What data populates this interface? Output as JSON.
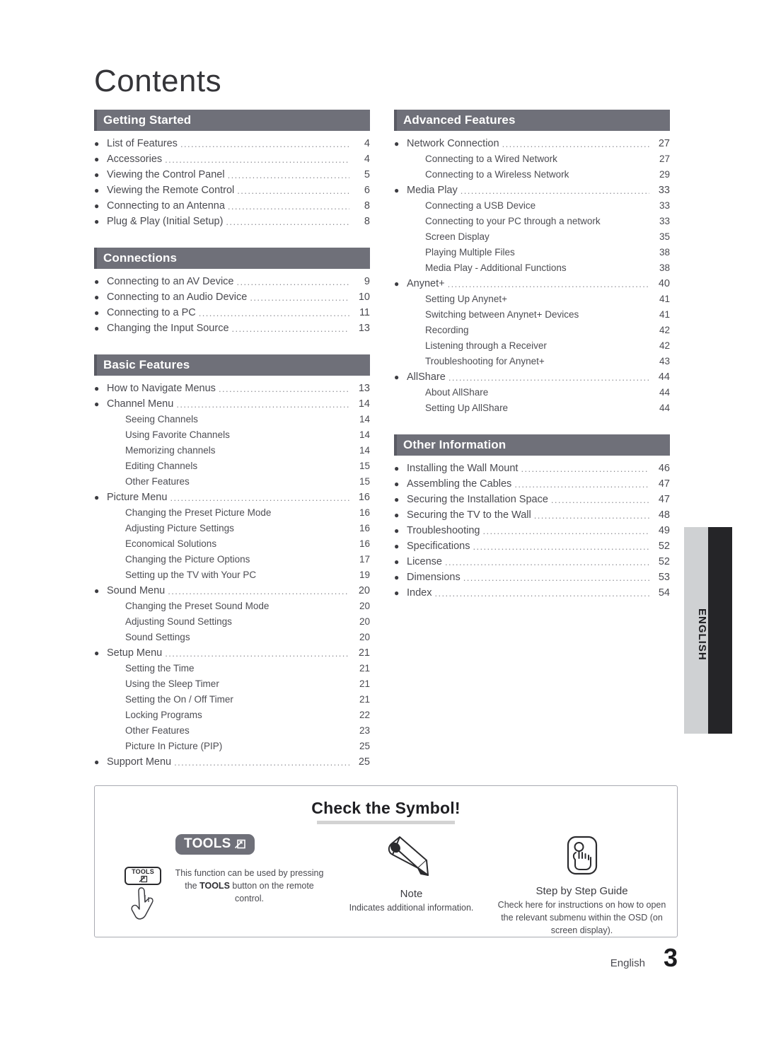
{
  "title": "Contents",
  "side_tab": {
    "label": "ENGLISH"
  },
  "columns": {
    "left": [
      {
        "heading": "Getting Started",
        "entries": [
          {
            "level": "main",
            "text": "List of Features",
            "page": "4"
          },
          {
            "level": "main",
            "text": "Accessories",
            "page": "4"
          },
          {
            "level": "main",
            "text": "Viewing the Control Panel",
            "page": "5"
          },
          {
            "level": "main",
            "text": "Viewing the Remote Control",
            "page": "6"
          },
          {
            "level": "main",
            "text": "Connecting to an Antenna",
            "page": "8"
          },
          {
            "level": "main",
            "text": "Plug & Play (Initial Setup)",
            "page": "8"
          }
        ]
      },
      {
        "heading": "Connections",
        "entries": [
          {
            "level": "main",
            "text": "Connecting to an AV Device",
            "page": "9"
          },
          {
            "level": "main",
            "text": "Connecting to an Audio Device",
            "page": "10"
          },
          {
            "level": "main",
            "text": "Connecting to a PC",
            "page": "11"
          },
          {
            "level": "main",
            "text": "Changing the Input Source",
            "page": "13"
          }
        ]
      },
      {
        "heading": "Basic Features",
        "entries": [
          {
            "level": "main",
            "text": "How to Navigate Menus",
            "page": "13"
          },
          {
            "level": "main",
            "text": "Channel Menu",
            "page": "14"
          },
          {
            "level": "sub",
            "text": "Seeing Channels",
            "page": "14"
          },
          {
            "level": "sub",
            "text": "Using Favorite Channels",
            "page": "14"
          },
          {
            "level": "sub",
            "text": "Memorizing channels",
            "page": "14"
          },
          {
            "level": "sub",
            "text": "Editing Channels",
            "page": "15"
          },
          {
            "level": "sub",
            "text": "Other Features",
            "page": "15"
          },
          {
            "level": "main",
            "text": "Picture Menu",
            "page": "16"
          },
          {
            "level": "sub",
            "text": "Changing the Preset Picture Mode",
            "page": "16"
          },
          {
            "level": "sub",
            "text": "Adjusting Picture Settings",
            "page": "16"
          },
          {
            "level": "sub",
            "text": "Economical Solutions",
            "page": "16"
          },
          {
            "level": "sub",
            "text": "Changing the Picture Options",
            "page": "17"
          },
          {
            "level": "sub",
            "text": "Setting up the TV with Your PC",
            "page": "19"
          },
          {
            "level": "main",
            "text": "Sound Menu",
            "page": "20"
          },
          {
            "level": "sub",
            "text": "Changing the Preset Sound Mode",
            "page": "20"
          },
          {
            "level": "sub",
            "text": "Adjusting Sound Settings",
            "page": "20"
          },
          {
            "level": "sub",
            "text": "Sound Settings",
            "page": "20"
          },
          {
            "level": "main",
            "text": "Setup Menu",
            "page": "21"
          },
          {
            "level": "sub",
            "text": "Setting the Time",
            "page": "21"
          },
          {
            "level": "sub",
            "text": "Using the Sleep Timer",
            "page": "21"
          },
          {
            "level": "sub",
            "text": "Setting the On / Off Timer",
            "page": "21"
          },
          {
            "level": "sub",
            "text": "Locking Programs",
            "page": "22"
          },
          {
            "level": "sub",
            "text": "Other Features",
            "page": "23"
          },
          {
            "level": "sub",
            "text": "Picture In Picture (PIP)",
            "page": "25"
          },
          {
            "level": "main",
            "text": "Support Menu",
            "page": "25"
          }
        ]
      }
    ],
    "right": [
      {
        "heading": "Advanced Features",
        "entries": [
          {
            "level": "main",
            "text": "Network Connection",
            "page": "27"
          },
          {
            "level": "sub",
            "text": "Connecting to a Wired Network",
            "page": "27"
          },
          {
            "level": "sub",
            "text": "Connecting to a Wireless Network",
            "page": "29"
          },
          {
            "level": "main",
            "text": "Media Play",
            "page": "33"
          },
          {
            "level": "sub",
            "text": "Connecting a USB Device",
            "page": "33"
          },
          {
            "level": "sub",
            "text": "Connecting to your PC through a network",
            "page": "33"
          },
          {
            "level": "sub",
            "text": "Screen Display",
            "page": "35"
          },
          {
            "level": "sub",
            "text": "Playing Multiple Files",
            "page": "38"
          },
          {
            "level": "sub",
            "text": "Media Play - Additional Functions",
            "page": "38"
          },
          {
            "level": "main",
            "text": "Anynet+",
            "page": "40"
          },
          {
            "level": "sub",
            "text": "Setting Up Anynet+",
            "page": "41"
          },
          {
            "level": "sub",
            "text": "Switching between Anynet+ Devices",
            "page": "41"
          },
          {
            "level": "sub",
            "text": "Recording",
            "page": "42"
          },
          {
            "level": "sub",
            "text": "Listening through a Receiver",
            "page": "42"
          },
          {
            "level": "sub",
            "text": "Troubleshooting for Anynet+",
            "page": "43"
          },
          {
            "level": "main",
            "text": "AllShare",
            "page": "44"
          },
          {
            "level": "sub",
            "text": "About AllShare",
            "page": "44"
          },
          {
            "level": "sub",
            "text": "Setting Up AllShare",
            "page": "44"
          }
        ]
      },
      {
        "heading": "Other Information",
        "entries": [
          {
            "level": "main",
            "text": "Installing the Wall Mount",
            "page": "46"
          },
          {
            "level": "main",
            "text": "Assembling the Cables",
            "page": "47"
          },
          {
            "level": "main",
            "text": "Securing the Installation Space",
            "page": "47"
          },
          {
            "level": "main",
            "text": "Securing the TV to the Wall",
            "page": "48"
          },
          {
            "level": "main",
            "text": "Troubleshooting",
            "page": "49"
          },
          {
            "level": "main",
            "text": "Specifications",
            "page": "52"
          },
          {
            "level": "main",
            "text": "License",
            "page": "52"
          },
          {
            "level": "main",
            "text": "Dimensions",
            "page": "53"
          },
          {
            "level": "main",
            "text": "Index",
            "page": "54"
          }
        ]
      }
    ]
  },
  "symbol_box": {
    "title": "Check the Symbol!",
    "tools": {
      "badge_label": "TOOLS",
      "remote_label": "TOOLS",
      "description_before": "This function can be used by pressing the ",
      "description_bold": "TOOLS",
      "description_after": " button on the remote control."
    },
    "note": {
      "caption": "Note",
      "description": "Indicates additional information."
    },
    "step": {
      "caption": "Step by Step Guide",
      "description": "Check here for instructions on how to open the relevant submenu within the OSD (on screen display)."
    }
  },
  "footer": {
    "language": "English",
    "page_number": "3"
  }
}
